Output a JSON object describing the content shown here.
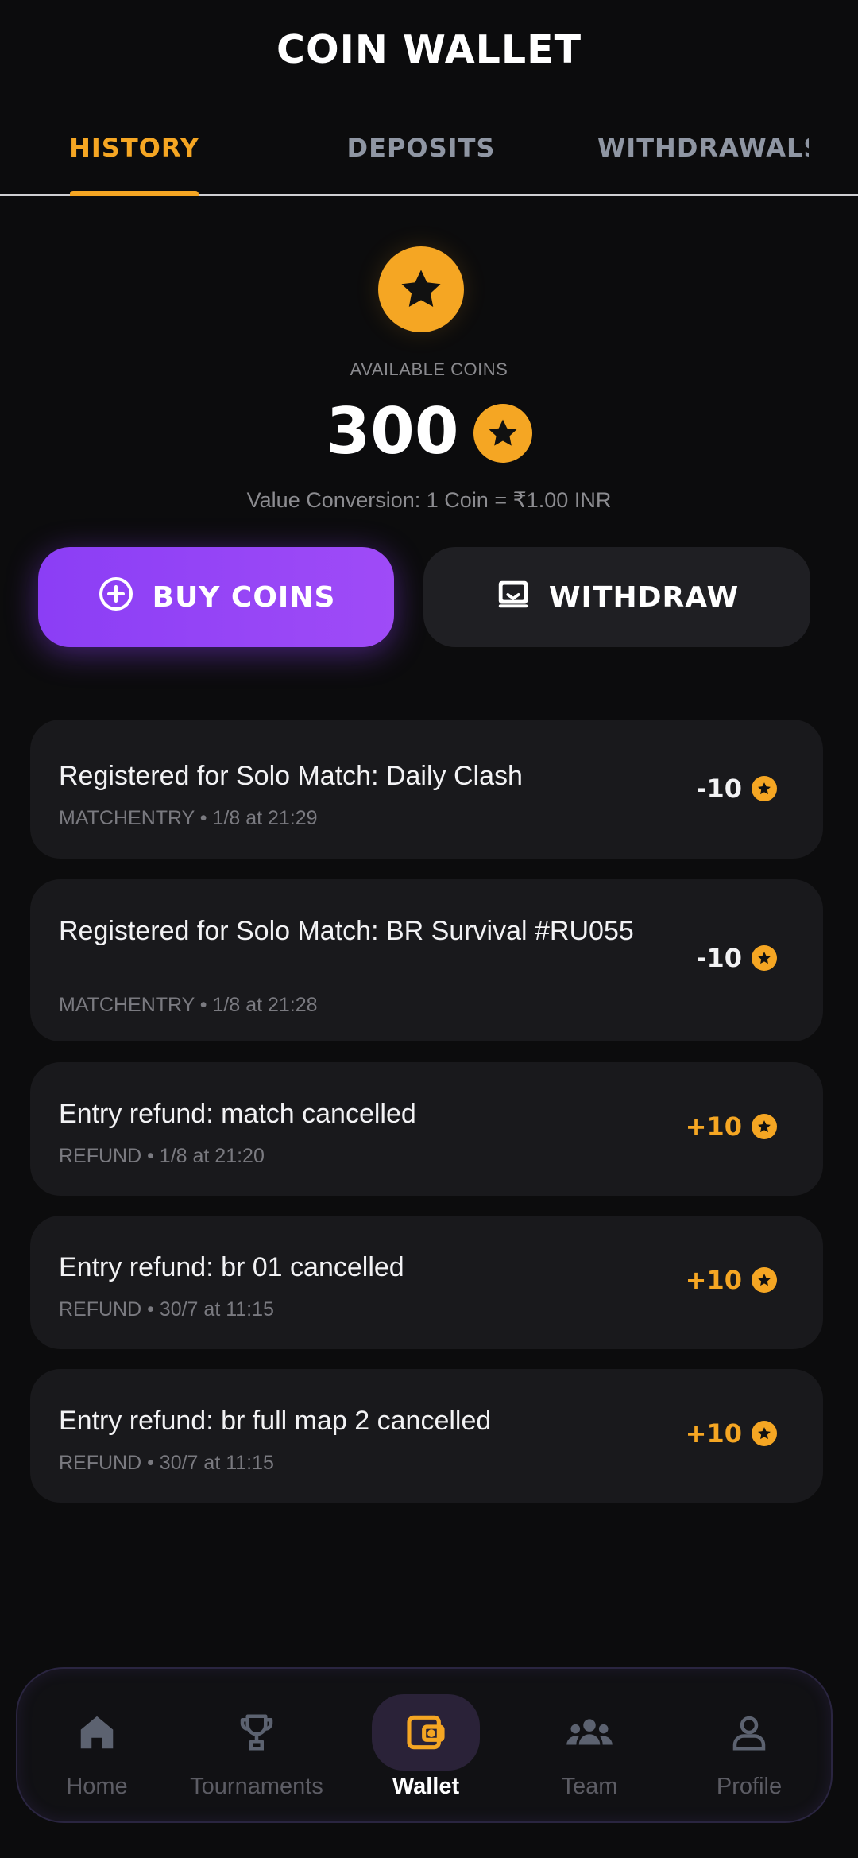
{
  "header": {
    "title": "COIN WALLET"
  },
  "tabs": [
    {
      "label": "HISTORY",
      "active": true
    },
    {
      "label": "DEPOSITS",
      "active": false
    },
    {
      "label": "WITHDRAWALS",
      "active": false
    }
  ],
  "balance": {
    "label": "AVAILABLE COINS",
    "value": "300",
    "conversion": "Value Conversion: 1 Coin = ₹1.00 INR",
    "icon": "star-coin-icon"
  },
  "actions": {
    "buy_label": "BUY COINS",
    "withdraw_label": "WITHDRAW"
  },
  "transactions": [
    {
      "title": "Registered for Solo Match: Daily Clash",
      "meta": "MATCHENTRY • 1/8 at 21:29",
      "amount": "-10",
      "type": "debit"
    },
    {
      "title": "Registered for Solo Match: BR Survival #RU055",
      "meta": "MATCHENTRY • 1/8 at 21:28",
      "amount": "-10",
      "type": "debit"
    },
    {
      "title": "Entry refund: match cancelled",
      "meta": "REFUND • 1/8 at 21:20",
      "amount": "+10",
      "type": "credit"
    },
    {
      "title": "Entry refund: br 01 cancelled",
      "meta": "REFUND • 30/7 at 11:15",
      "amount": "+10",
      "type": "credit"
    },
    {
      "title": "Entry refund: br full map 2 cancelled",
      "meta": "REFUND • 30/7 at 11:15",
      "amount": "+10",
      "type": "credit"
    }
  ],
  "nav": [
    {
      "label": "Home",
      "icon": "home-icon",
      "active": false
    },
    {
      "label": "Tournaments",
      "icon": "trophy-icon",
      "active": false
    },
    {
      "label": "Wallet",
      "icon": "wallet-icon",
      "active": true
    },
    {
      "label": "Team",
      "icon": "team-icon",
      "active": false
    },
    {
      "label": "Profile",
      "icon": "profile-icon",
      "active": false
    }
  ],
  "colors": {
    "accent": "#f5a623",
    "primary_button": "#8b3ef5",
    "background": "#0c0c0d",
    "card": "#19191c"
  }
}
